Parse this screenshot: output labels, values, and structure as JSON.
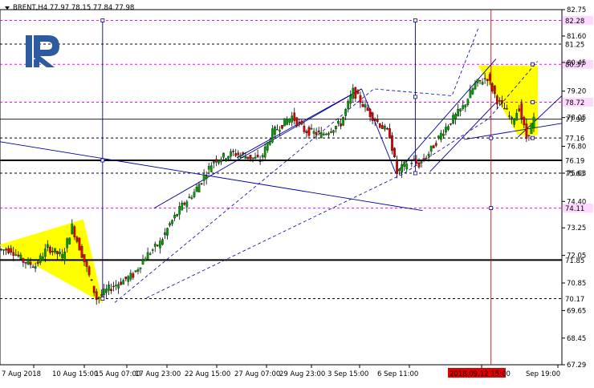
{
  "chart_data": {
    "type": "candlestick",
    "symbol_line": "BRENT,H4  77.97 78.15 77.84 77.98",
    "y_axis": {
      "min": 67.29,
      "max": 82.75,
      "tick_labels": [
        "82.75",
        "81.60",
        "80.45",
        "79.20",
        "78.05",
        "76.80",
        "75.63",
        "74.40",
        "73.25",
        "72.05",
        "70.85",
        "69.65",
        "68.45",
        "67.29"
      ]
    },
    "x_axis": {
      "tick_labels": [
        "7 Aug 2018",
        "10 Aug 15:00",
        "15 Aug 07:00",
        "17 Aug 23:00",
        "22 Aug 15:00",
        "27 Aug 07:00",
        "29 Aug 23:00",
        "3 Sep 15:00",
        "6 Sep 11:00",
        "2018.09.12 15:00",
        "Sep 19:00"
      ]
    },
    "price_levels": [
      {
        "value": 82.28,
        "label": "82.28",
        "color": "#ff00ff",
        "style": "dashed"
      },
      {
        "value": 81.25,
        "label": "81.25",
        "color": "#000000",
        "style": "dashed"
      },
      {
        "value": 80.37,
        "label": "80.37",
        "color": "#ff00ff",
        "style": "dashed"
      },
      {
        "value": 78.72,
        "label": "78.72",
        "color": "#ff00ff",
        "style": "dashed"
      },
      {
        "value": 77.98,
        "label": "77.98",
        "color": "#000000",
        "style": "current"
      },
      {
        "value": 77.16,
        "label": "77.16",
        "color": "#000000",
        "style": "dashed"
      },
      {
        "value": 76.19,
        "label": "76.19",
        "color": "#000000",
        "style": "solid"
      },
      {
        "value": 75.63,
        "label": "75.63",
        "color": "#000000",
        "style": "dashed"
      },
      {
        "value": 74.11,
        "label": "74.11",
        "color": "#ff00ff",
        "style": "dashed"
      },
      {
        "value": 71.85,
        "label": "71.85",
        "color": "#000000",
        "style": "solid"
      },
      {
        "value": 70.17,
        "label": "70.17",
        "color": "#000000",
        "style": "dashed"
      }
    ],
    "colors": {
      "bull": "#00a000",
      "bear": "#e00000",
      "trendline": "#0000a0",
      "highlight": "#ffff00",
      "accent_magenta": "#ff00ff",
      "time_marker": "#e00000",
      "logo": "#2e5aa0"
    },
    "path_points": [
      [
        0,
        72.3
      ],
      [
        5,
        72.3
      ],
      [
        10,
        71.8
      ],
      [
        15,
        71.6
      ],
      [
        20,
        72.4
      ],
      [
        26,
        72.0
      ],
      [
        30,
        73.3
      ],
      [
        35,
        71.8
      ],
      [
        40,
        70.17
      ],
      [
        45,
        70.6
      ],
      [
        55,
        71.2
      ],
      [
        60,
        72.0
      ],
      [
        66,
        72.6
      ],
      [
        70,
        73.4
      ],
      [
        75,
        74.2
      ],
      [
        80,
        74.8
      ],
      [
        88,
        76.2
      ],
      [
        96,
        76.5
      ],
      [
        100,
        76.4
      ],
      [
        107,
        76.2
      ],
      [
        112,
        77.4
      ],
      [
        120,
        78.1
      ],
      [
        125,
        77.5
      ],
      [
        132,
        77.3
      ],
      [
        140,
        77.8
      ],
      [
        145,
        79.2
      ],
      [
        152,
        78.2
      ],
      [
        160,
        77.3
      ],
      [
        163,
        75.63
      ],
      [
        168,
        76.2
      ],
      [
        172,
        76.0
      ],
      [
        176,
        76.5
      ],
      [
        182,
        77.5
      ],
      [
        190,
        78.5
      ],
      [
        195,
        79.5
      ],
      [
        200,
        79.8
      ],
      [
        204,
        78.8
      ],
      [
        208,
        78.3
      ],
      [
        210,
        77.9
      ],
      [
        213,
        78.5
      ],
      [
        216,
        77.16
      ],
      [
        219,
        77.98
      ]
    ],
    "trend_lines": [
      {
        "x1": 0,
        "y1": 77.0,
        "x2": 173,
        "y2": 74.0
      },
      {
        "x1": 63,
        "y1": 74.1,
        "x2": 148,
        "y2": 79.3
      },
      {
        "x1": 97,
        "y1": 76.3,
        "x2": 148,
        "y2": 79.3
      },
      {
        "x1": 148,
        "y1": 79.3,
        "x2": 162,
        "y2": 75.63
      },
      {
        "x1": 162,
        "y1": 75.63,
        "x2": 203,
        "y2": 80.6
      },
      {
        "x1": 176,
        "y1": 75.7,
        "x2": 203,
        "y2": 78.7
      },
      {
        "x1": 212,
        "y1": 77.2,
        "x2": 230,
        "y2": 79.0
      },
      {
        "x1": 190,
        "y1": 77.1,
        "x2": 230,
        "y2": 77.8
      }
    ],
    "channels": [
      {
        "points": [
          [
            47,
            70.0
          ],
          [
            153,
            79.3
          ],
          [
            185,
            79.0
          ],
          [
            196,
            82.0
          ]
        ]
      },
      {
        "points": [
          [
            60,
            70.2
          ],
          [
            165,
            75.6
          ],
          [
            200,
            78.0
          ],
          [
            220,
            80.5
          ]
        ]
      }
    ],
    "vertical_markers": [
      {
        "x": 42,
        "from": 82.28,
        "to": 70.1
      },
      {
        "x": 170,
        "from": 82.28,
        "to": 75.63
      },
      {
        "x": 201,
        "from": 82.75,
        "to": 67.29,
        "color": "#e00000"
      }
    ],
    "small_markers": [
      [
        42,
        82.28
      ],
      [
        42,
        76.19
      ],
      [
        42,
        70.17
      ],
      [
        170,
        82.28
      ],
      [
        170,
        78.95
      ],
      [
        170,
        75.63
      ],
      [
        201,
        77.16
      ],
      [
        201,
        74.11
      ],
      [
        218,
        80.37
      ],
      [
        218,
        78.72
      ],
      [
        218,
        77.16
      ]
    ],
    "triangles": [
      {
        "points": [
          [
            0,
            72.5
          ],
          [
            34,
            73.6
          ],
          [
            42,
            70.0
          ]
        ]
      },
      {
        "points": [
          [
            196,
            80.3
          ],
          [
            220,
            80.3
          ],
          [
            220,
            77.3
          ],
          [
            212,
            77.3
          ]
        ]
      }
    ],
    "grid": false,
    "x_range": [
      0,
      230
    ]
  }
}
